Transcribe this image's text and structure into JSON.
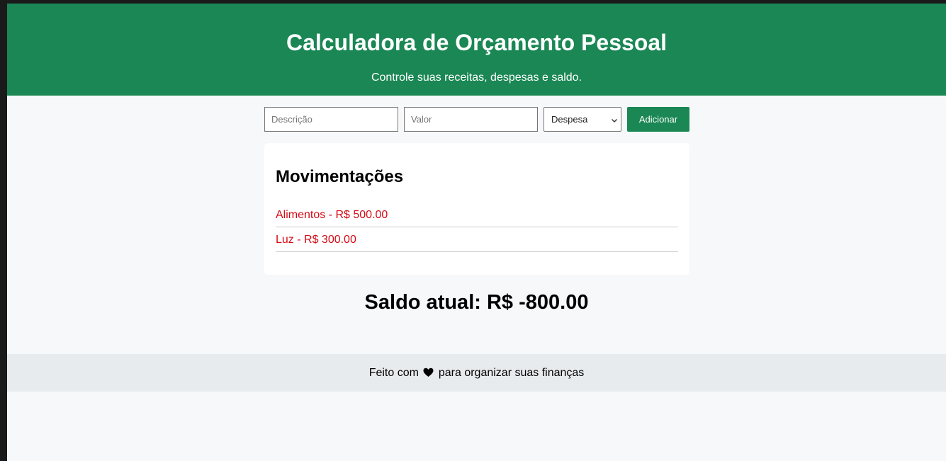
{
  "header": {
    "title": "Calculadora de Orçamento Pessoal",
    "subtitle": "Controle suas receitas, despesas e saldo."
  },
  "form": {
    "description_placeholder": "Descrição",
    "value_placeholder": "Valor",
    "type_selected": "Despesa",
    "add_label": "Adicionar"
  },
  "movements": {
    "title": "Movimentações",
    "items": [
      {
        "text": "Alimentos - R$ 500.00",
        "type": "Despesa"
      },
      {
        "text": "Luz - R$ 300.00",
        "type": "Despesa"
      }
    ],
    "expense_color": "#d60a15"
  },
  "balance": {
    "text": "Saldo atual: R$ -800.00"
  },
  "footer": {
    "before": "Feito com",
    "icon": "heart-icon",
    "after": "para organizar suas finanças"
  },
  "colors": {
    "brand": "#1a8754",
    "background": "#f6f8fa",
    "footer_bg": "#e8ebee"
  }
}
